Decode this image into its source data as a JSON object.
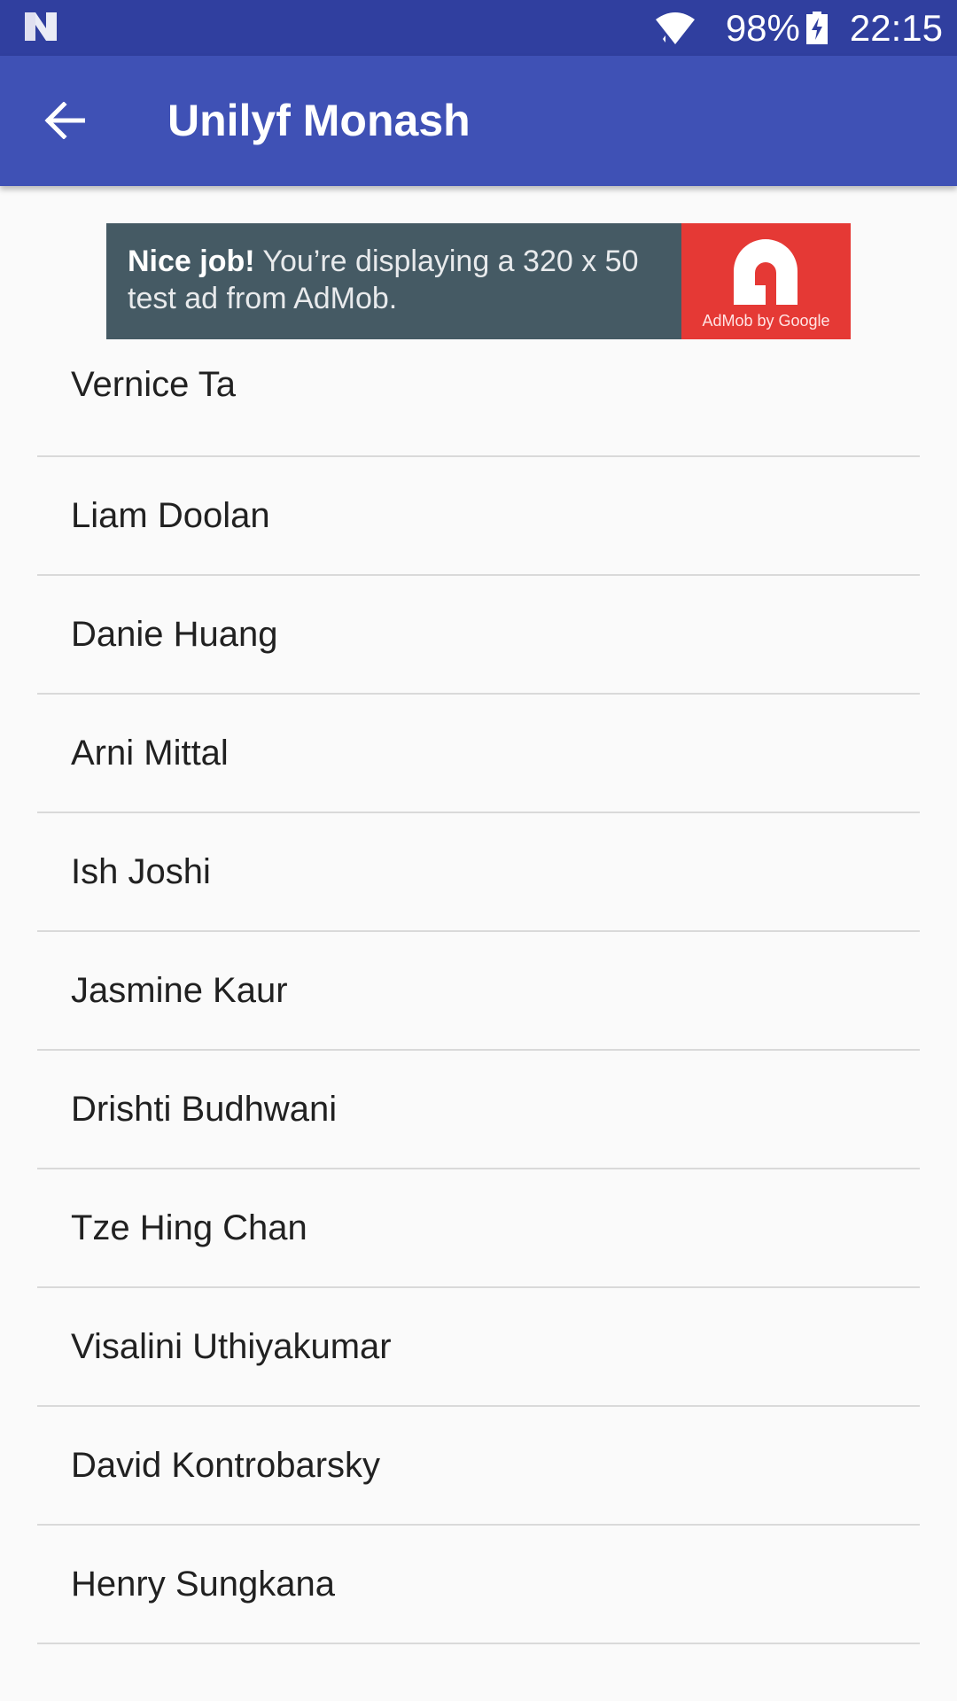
{
  "status_bar": {
    "battery_percent": "98%",
    "time": "22:15",
    "icons": [
      "n-notification-icon",
      "wifi-icon",
      "battery-charging-icon"
    ]
  },
  "app_bar": {
    "title": "Unilyf Monash",
    "back_icon": "arrow-back-icon",
    "color": "#3f51b5",
    "status_color": "#303f9f"
  },
  "ad": {
    "headline": "Nice job!",
    "body": "You’re displaying a 320 x 50 test ad from AdMob.",
    "brand": "AdMob by Google",
    "bg_color": "#455a64",
    "logo_color": "#e53935"
  },
  "members": [
    {
      "name": "Vernice Ta"
    },
    {
      "name": "Liam Doolan"
    },
    {
      "name": "Danie Huang"
    },
    {
      "name": "Arni Mittal"
    },
    {
      "name": "Ish Joshi"
    },
    {
      "name": "Jasmine Kaur"
    },
    {
      "name": "Drishti Budhwani"
    },
    {
      "name": "Tze Hing Chan"
    },
    {
      "name": "Visalini Uthiyakumar"
    },
    {
      "name": "David Kontrobarsky"
    },
    {
      "name": "Henry Sungkana"
    }
  ]
}
